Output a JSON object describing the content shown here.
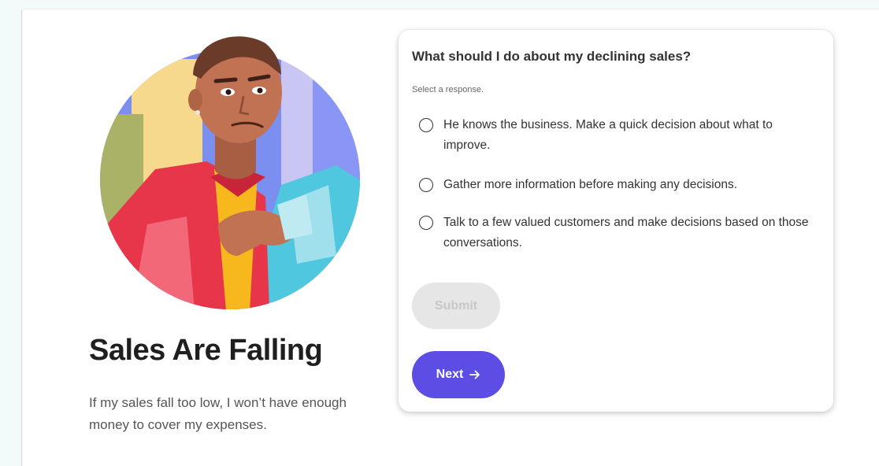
{
  "scenario": {
    "title": "Sales Are Falling",
    "description": "If my sales fall too low, I won’t have enough money to cover my expenses."
  },
  "question": {
    "text": "What should I do about my declining sales?",
    "instruction": "Select a response.",
    "options": [
      {
        "label": "He knows the business. Make a quick decision about what to improve.",
        "selected": false
      },
      {
        "label": "Gather more information before making any decisions.",
        "selected": false
      },
      {
        "label": "Talk to a few valued customers and make decisions based on those conversations.",
        "selected": false
      }
    ]
  },
  "buttons": {
    "submit_label": "Submit",
    "submit_enabled": false,
    "next_label": "Next"
  },
  "icons": {
    "next": "arrow-right-icon",
    "illustration": "person-character-illustration"
  },
  "colors": {
    "accent": "#5c4ee5",
    "disabled_bg": "#e6e6e6",
    "disabled_text": "#c8c8c8",
    "title_text": "#1f1f1f",
    "body_text": "#555555"
  }
}
